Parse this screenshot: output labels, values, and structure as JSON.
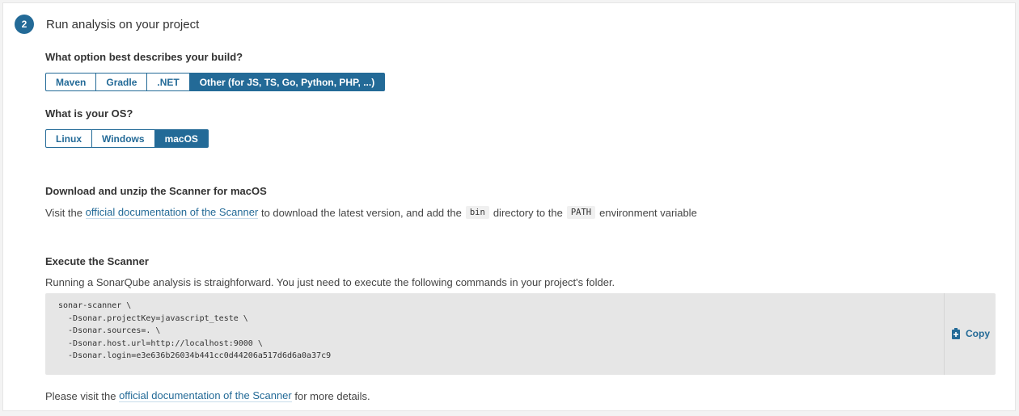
{
  "step": {
    "number": "2",
    "title": "Run analysis on your project"
  },
  "build": {
    "question": "What option best describes your build?",
    "options": [
      "Maven",
      "Gradle",
      ".NET",
      "Other (for JS, TS, Go, Python, PHP, ...)"
    ],
    "selected": "Other (for JS, TS, Go, Python, PHP, ...)"
  },
  "os": {
    "question": "What is your OS?",
    "options": [
      "Linux",
      "Windows",
      "macOS"
    ],
    "selected": "macOS"
  },
  "download": {
    "title": "Download and unzip the Scanner for macOS",
    "text_before": "Visit the",
    "link": "official documentation of the Scanner",
    "text_middle": "to download the latest version, and add the",
    "code1": "bin",
    "text_middle2": "directory to the",
    "code2": "PATH",
    "text_after": "environment variable"
  },
  "execute": {
    "title": "Execute the Scanner",
    "description": "Running a SonarQube analysis is straighforward. You just need to execute the following commands in your project's folder.",
    "code_lines": [
      "sonar-scanner \\",
      "  -Dsonar.projectKey=javascript_teste \\",
      "  -Dsonar.sources=. \\",
      "  -Dsonar.host.url=http://localhost:9000 \\",
      "  -Dsonar.login=e3e636b26034b441cc0d44206a517d6d6a0a37c9"
    ],
    "copy_label": "Copy"
  },
  "footer": {
    "text_before": "Please visit the",
    "link": "official documentation of the Scanner",
    "text_after": "for more details."
  },
  "colors": {
    "accent": "#236a97",
    "code_bg": "#e6e6e6"
  },
  "icons": {
    "copy": "clipboard-plus-icon"
  }
}
